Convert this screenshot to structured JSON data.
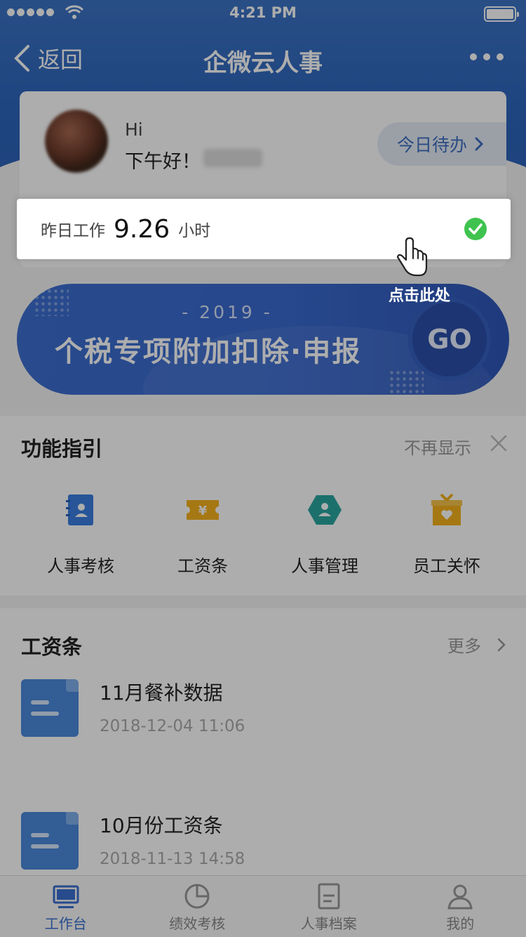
{
  "status_bar": {
    "time": "4:21 PM"
  },
  "nav": {
    "back_label": "返回",
    "title": "企微云人事"
  },
  "user": {
    "greeting_hi": "Hi",
    "greeting": "下午好！",
    "todo_button": "今日待办"
  },
  "work": {
    "label": "昨日工作",
    "value": "9.26",
    "unit": "小时"
  },
  "tax_banner": {
    "year": "- 2019 -",
    "title": "个税专项附加扣除·申报",
    "go": "GO"
  },
  "click_hint": "点击此处",
  "guide": {
    "title": "功能指引",
    "dismiss": "不再显示",
    "items": [
      {
        "label": "人事考核",
        "icon": "appraisal-book-icon",
        "color": "#3a7ee0"
      },
      {
        "label": "工资条",
        "icon": "salary-ticket-icon",
        "color": "#f5b21c"
      },
      {
        "label": "人事管理",
        "icon": "hr-management-hexagon-icon",
        "color": "#2aa5a0"
      },
      {
        "label": "员工关怀",
        "icon": "gift-care-icon",
        "color": "#f5b21c"
      }
    ]
  },
  "salary": {
    "title": "工资条",
    "more": "更多",
    "items": [
      {
        "name": "11月餐补数据",
        "date": "2018-12-04 11:06"
      },
      {
        "name": "10月份工资条",
        "date": "2018-11-13 14:58"
      }
    ]
  },
  "tabs": [
    {
      "label": "工作台",
      "icon": "monitor-icon",
      "active": true
    },
    {
      "label": "绩效考核",
      "icon": "pie-chart-icon",
      "active": false
    },
    {
      "label": "人事档案",
      "icon": "document-icon",
      "active": false
    },
    {
      "label": "我的",
      "icon": "person-icon",
      "active": false
    }
  ],
  "colors": {
    "brand_blue": "#3a6fd0",
    "check_green": "#3fc34e"
  }
}
